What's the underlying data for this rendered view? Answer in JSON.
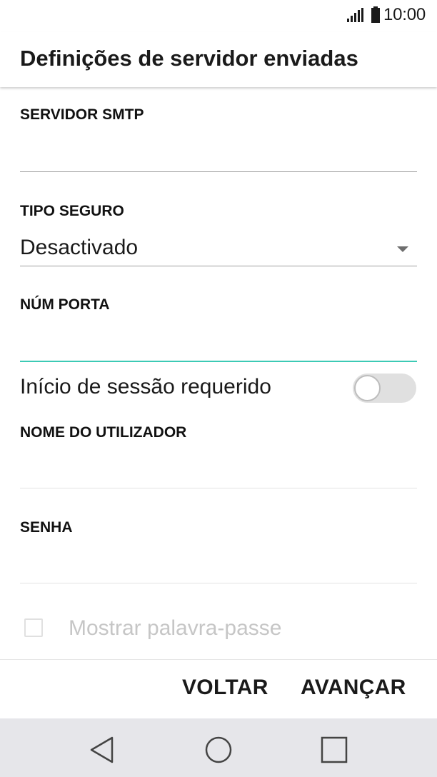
{
  "status_bar": {
    "time": "10:00",
    "icons": [
      "signal-icon",
      "battery-icon"
    ]
  },
  "header": {
    "title": "Definições de servidor enviadas"
  },
  "form": {
    "smtp_server": {
      "label": "SERVIDOR SMTP",
      "value": ""
    },
    "security_type": {
      "label": "TIPO SEGURO",
      "value": "Desactivado"
    },
    "port_number": {
      "label": "NÚM PORTA",
      "value": ""
    },
    "login_required": {
      "label": "Início de sessão requerido",
      "enabled": false
    },
    "username": {
      "label": "NOME DO UTILIZADOR",
      "value": ""
    },
    "password": {
      "label": "SENHA",
      "value": ""
    },
    "show_password": {
      "label": "Mostrar palavra-passe",
      "checked": false
    }
  },
  "actions": {
    "back_label": "VOLTAR",
    "next_label": "AVANÇAR"
  },
  "navigation": {
    "icons": [
      "back-icon",
      "home-icon",
      "recents-icon"
    ]
  },
  "colors": {
    "accent": "#3ccab5",
    "nav_bar": "#e6e6ea",
    "disabled_text": "#c6c6c6"
  }
}
